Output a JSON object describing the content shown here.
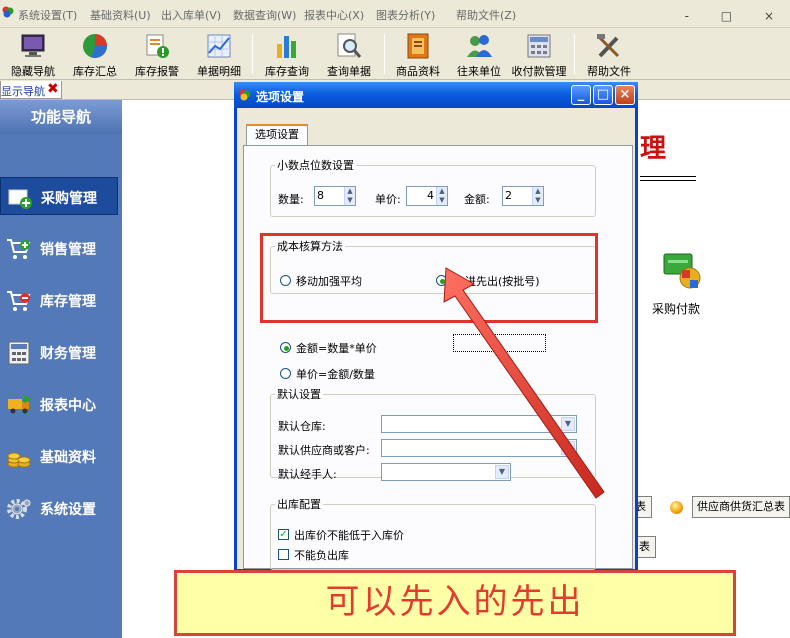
{
  "menubar": {
    "items": [
      "系统设置(T)",
      "基础资料(U)",
      "出入库单(V)",
      "数据查询(W)",
      "报表中心(X)",
      "图表分析(Y)",
      "帮助文件(Z)"
    ],
    "window_controls": "- □ ×"
  },
  "toolbar": {
    "buttons": [
      {
        "label": "隐藏导航",
        "icon": "monitor-icon"
      },
      {
        "label": "库存汇总",
        "icon": "pie-chart-icon"
      },
      {
        "label": "库存报警",
        "icon": "alarm-icon"
      },
      {
        "label": "单据明细",
        "icon": "line-chart-icon"
      },
      {
        "label": "库存查询",
        "icon": "bar-chart-icon"
      },
      {
        "label": "查询单据",
        "icon": "magnifier-icon"
      },
      {
        "label": "商品资料",
        "icon": "book-icon"
      },
      {
        "label": "往来单位",
        "icon": "people-icon"
      },
      {
        "label": "收付款管理",
        "icon": "calculator-icon"
      },
      {
        "label": "帮助文件",
        "icon": "tools-icon"
      }
    ]
  },
  "tabbar": {
    "nav_tab_label": "显示导航",
    "close_glyph": "✖"
  },
  "sidebar": {
    "header": "功能导航",
    "items": [
      {
        "label": "采购管理",
        "icon": "purchase-cart-icon",
        "selected": true
      },
      {
        "label": "销售管理",
        "icon": "sales-cart-icon",
        "selected": false
      },
      {
        "label": "库存管理",
        "icon": "stock-cart-icon",
        "selected": false
      },
      {
        "label": "财务管理",
        "icon": "finance-calculator-icon",
        "selected": false
      },
      {
        "label": "报表中心",
        "icon": "report-truck-icon",
        "selected": false
      },
      {
        "label": "基础资料",
        "icon": "coins-icon",
        "selected": false
      },
      {
        "label": "系统设置",
        "icon": "gear-icon",
        "selected": false
      }
    ]
  },
  "background": {
    "title_fragment": "理",
    "pay_label": "采购付款",
    "button1_fragment": "表",
    "button2": "供应商供货汇总表",
    "button3_fragment": "表"
  },
  "dialog": {
    "title": "选项设置",
    "tab": "选项设置",
    "decimal": {
      "legend": "小数点位数设置",
      "qty_label": "数量:",
      "qty_value": "8",
      "price_label": "单价:",
      "price_value": "4",
      "amount_label": "金额:",
      "amount_value": "2"
    },
    "costing": {
      "legend": "成本核算方法",
      "option1": "移动加强平均",
      "option2": "先进先出(按批号)",
      "selected": "option2"
    },
    "formula": {
      "option1": "金额=数量*单价",
      "option2": "单价=金额/数量",
      "selected": "option1"
    },
    "defaults": {
      "legend": "默认设置",
      "warehouse_label": "默认仓库:",
      "warehouse_value": "",
      "supplier_label": "默认供应商或客户:",
      "supplier_value": "",
      "handler_label": "默认经手人:",
      "handler_value": ""
    },
    "outbound": {
      "legend": "出库配置",
      "check1": "出库价不能低于入库价",
      "check1_checked": true,
      "check2": "不能负出库",
      "check2_checked": false
    }
  },
  "annotation": {
    "caption": "可以先入的先出",
    "color": "#e0332a"
  }
}
